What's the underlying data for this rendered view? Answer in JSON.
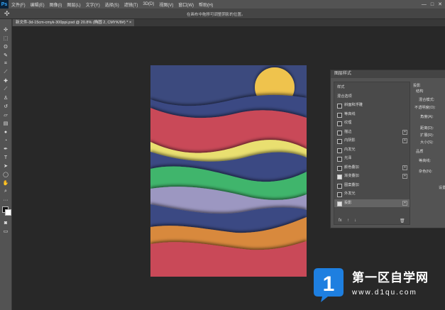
{
  "app": {
    "logo": "Ps"
  },
  "menubar": {
    "items": [
      "文件(F)",
      "编辑(E)",
      "图像(I)",
      "图层(L)",
      "文字(Y)",
      "选择(S)",
      "滤镜(T)",
      "3D(D)",
      "视图(V)",
      "窗口(W)",
      "帮助(H)"
    ],
    "window_controls": [
      "—",
      "□",
      "✕"
    ]
  },
  "options_bar": {
    "hint": "在画布中拖移可调整阴影的位置。"
  },
  "document": {
    "tab_label": "新文件-3d-15cm-cmyk-300ppi.psd @ 20.8% (椭圆 2, CMYK/8#) *  ×"
  },
  "layer_style_dialog": {
    "title": "图层样式",
    "items": [
      {
        "label": "样式",
        "checkbox": false,
        "plus": false,
        "checked": false,
        "active": false
      },
      {
        "label": "混合选项",
        "checkbox": false,
        "plus": false,
        "checked": false,
        "active": false
      },
      {
        "label": "斜面和浮雕",
        "checkbox": true,
        "plus": false,
        "checked": false,
        "active": false
      },
      {
        "label": "等高线",
        "checkbox": true,
        "plus": false,
        "checked": false,
        "active": false
      },
      {
        "label": "纹理",
        "checkbox": true,
        "plus": false,
        "checked": false,
        "active": false
      },
      {
        "label": "描边",
        "checkbox": true,
        "plus": true,
        "checked": false,
        "active": false
      },
      {
        "label": "内阴影",
        "checkbox": true,
        "plus": true,
        "checked": false,
        "active": false
      },
      {
        "label": "内发光",
        "checkbox": true,
        "plus": false,
        "checked": false,
        "active": false
      },
      {
        "label": "光泽",
        "checkbox": true,
        "plus": false,
        "checked": false,
        "active": false
      },
      {
        "label": "颜色叠加",
        "checkbox": true,
        "plus": true,
        "checked": false,
        "active": false
      },
      {
        "label": "渐变叠加",
        "checkbox": true,
        "plus": true,
        "checked": true,
        "active": false
      },
      {
        "label": "图案叠加",
        "checkbox": true,
        "plus": false,
        "checked": false,
        "active": false
      },
      {
        "label": "外发光",
        "checkbox": true,
        "plus": false,
        "checked": false,
        "active": false
      },
      {
        "label": "投影",
        "checkbox": true,
        "plus": true,
        "checked": true,
        "active": true
      }
    ],
    "footer_icons": [
      "fx",
      "↑",
      "↓",
      "🗑"
    ],
    "right_panel": {
      "section_title": "投影",
      "subsection": "结构",
      "fields": [
        "混合模式:",
        "不透明度(O):",
        "角度(A):",
        "距离(D):",
        "扩展(R):",
        "大小(S):"
      ],
      "quality_title": "品质",
      "contour_label": "等高线:",
      "noise_label": "杂色(N):",
      "default_button": "设置"
    }
  },
  "watermark": {
    "logo_char": "1",
    "title": "第一区自学网",
    "url": "www.d1qu.com",
    "color": "#1e7fe0"
  },
  "artwork_colors": {
    "background": "#3c4a7e",
    "sun": "#efc34e",
    "red": "#c94858",
    "yellow": "#e9df70",
    "green": "#3fb56c",
    "lavender": "#9c97c1",
    "navy": "#3b4983",
    "orange": "#d8893c"
  }
}
